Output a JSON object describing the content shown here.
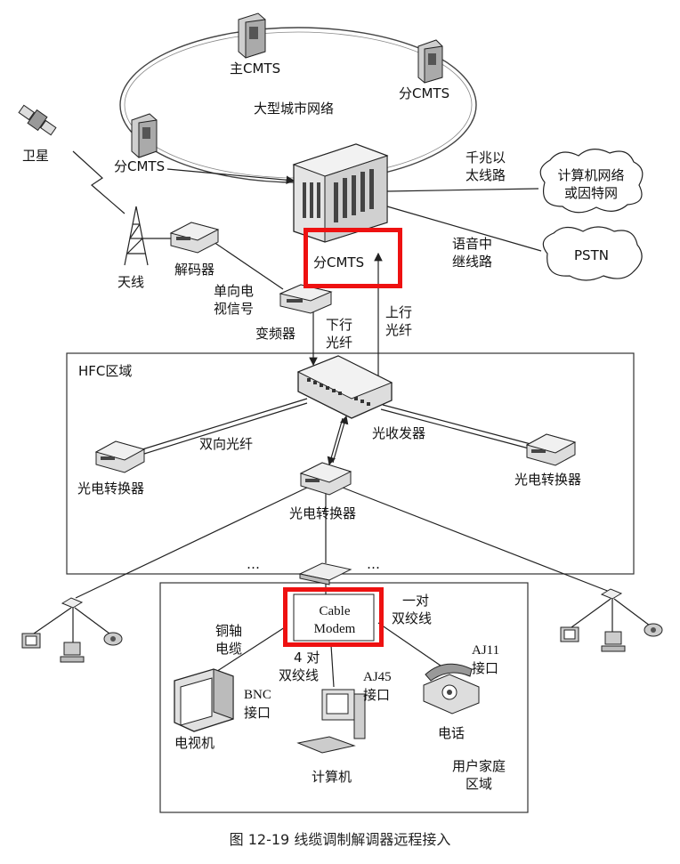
{
  "labels": {
    "satellite": "卫星",
    "antenna": "天线",
    "decoder": "解码器",
    "one_way_tv_l1": "单向电",
    "one_way_tv_l2": "视信号",
    "frequency_converter": "变频器",
    "main_cmts": "主CMTS",
    "sub_cmts_right": "分CMTS",
    "sub_cmts_left": "分CMTS",
    "sub_cmts_center": "分CMTS",
    "metro_network": "大型城市网络",
    "gigabit_l1": "千兆以",
    "gigabit_l2": "太线路",
    "internet_l1": "计算机网络",
    "internet_l2": "或因特网",
    "voice_trunk_l1": "语音中",
    "voice_trunk_l2": "继线路",
    "pstn": "PSTN",
    "down_fiber_l1": "下行",
    "down_fiber_l2": "光纤",
    "up_fiber_l1": "上行",
    "up_fiber_l2": "光纤",
    "hfc_area": "HFC区域",
    "optical_transceiver": "光收发器",
    "bidirectional_fiber": "双向光纤",
    "oe_converter_left": "光电转换器",
    "oe_converter_right": "光电转换器",
    "oe_converter_center": "光电转换器",
    "ellipsis_left": "…",
    "ellipsis_right": "…",
    "cable_modem_l1": "Cable",
    "cable_modem_l2": "Modem",
    "coax_l1": "铜轴",
    "coax_l2": "电缆",
    "twisted_pair_one_l1": "一对",
    "twisted_pair_one_l2": "双绞线",
    "twisted_pair_four_l1": "4 对",
    "twisted_pair_four_l2": "双绞线",
    "bnc_l1": "BNC",
    "bnc_l2": "接口",
    "aj45_l1": "AJ45",
    "aj45_l2": "接口",
    "aj11_l1": "AJ11",
    "aj11_l2": "接口",
    "tv": "电视机",
    "computer": "计算机",
    "phone": "电话",
    "home_area_l1": "用户家庭",
    "home_area_l2": "区域"
  },
  "caption": "图 12-19    线缆调制解调器远程接入",
  "colors": {
    "highlight": "#ee1111",
    "line": "#222222",
    "device_fill": "#e4e4e4"
  }
}
